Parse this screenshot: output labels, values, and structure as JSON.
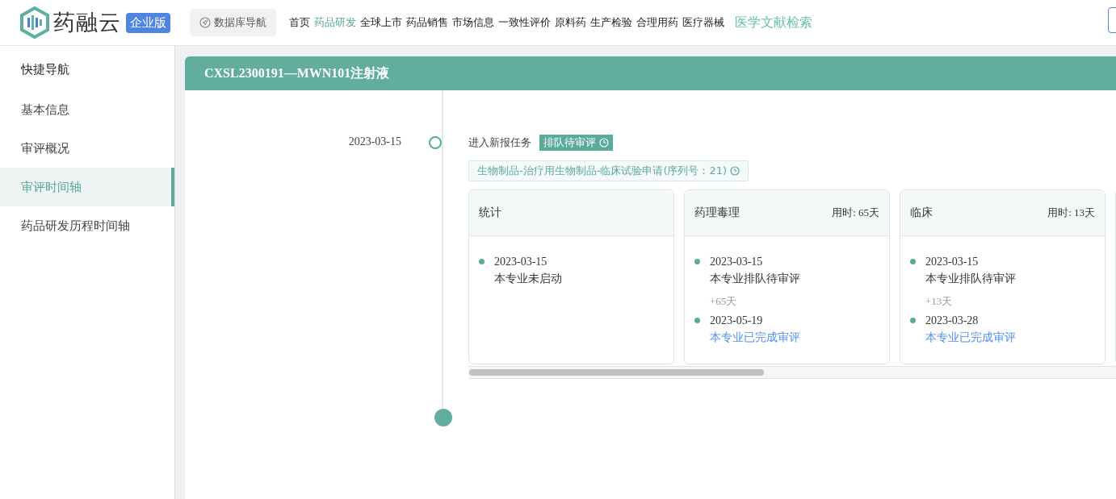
{
  "topbar": {
    "logo_text": "药融云",
    "edition": "企业版",
    "db_nav": "数据库导航",
    "nav": [
      {
        "label": "首页",
        "selected": false
      },
      {
        "label": "药品研发",
        "selected": true
      },
      {
        "label": "全球上市",
        "selected": false
      },
      {
        "label": "药品销售",
        "selected": false
      },
      {
        "label": "市场信息",
        "selected": false
      },
      {
        "label": "一致性评价",
        "selected": false
      },
      {
        "label": "原料药",
        "selected": false
      },
      {
        "label": "生产检验",
        "selected": false
      },
      {
        "label": "合理用药",
        "selected": false
      },
      {
        "label": "医疗器械",
        "selected": false
      }
    ],
    "literature_link": "医学文献检索"
  },
  "sidebar": {
    "title": "快捷导航",
    "items": [
      {
        "label": "基本信息",
        "selected": false
      },
      {
        "label": "审评概况",
        "selected": false
      },
      {
        "label": "审评时间轴",
        "selected": true
      },
      {
        "label": "药品研发历程时间轴",
        "selected": false
      }
    ]
  },
  "panel": {
    "title": "CXSL2300191—MWN101注射液",
    "event": {
      "date": "2023-03-15",
      "task": "进入新报任务",
      "status": "排队待审评",
      "category": "生物制品-治疗用生物制品-临床试验申请(序列号：21)",
      "cards": [
        {
          "name": "统计",
          "entries": [
            {
              "kind": "step",
              "date": "2023-03-15",
              "text": "本专业未启动",
              "done": false
            }
          ]
        },
        {
          "name": "药理毒理",
          "duration": "用时: 65天",
          "entries": [
            {
              "kind": "step",
              "date": "2023-03-15",
              "text": "本专业排队待审评",
              "done": false
            },
            {
              "kind": "gap",
              "text": "+65天"
            },
            {
              "kind": "step",
              "date": "2023-05-19",
              "text": "本专业已完成审评",
              "done": true
            }
          ]
        },
        {
          "name": "临床",
          "duration": "用时: 13天",
          "entries": [
            {
              "kind": "step",
              "date": "2023-03-15",
              "text": "本专业排队待审评",
              "done": false
            },
            {
              "kind": "gap",
              "text": "+13天"
            },
            {
              "kind": "step",
              "date": "2023-03-28",
              "text": "本专业已完成审评",
              "done": true
            }
          ]
        }
      ]
    }
  }
}
